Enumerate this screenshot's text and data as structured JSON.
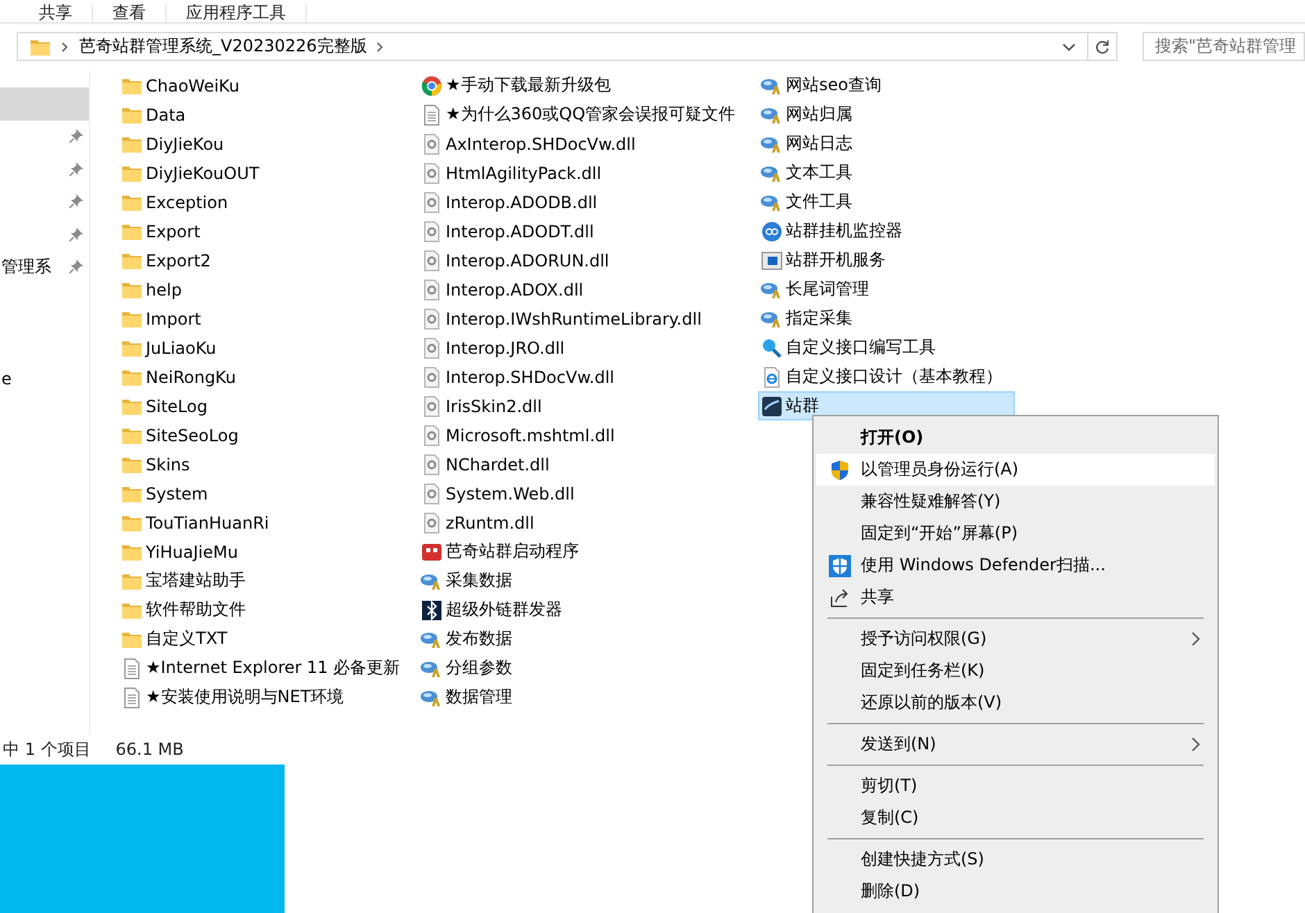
{
  "ribbon_tabs": [
    {
      "label": "共享"
    },
    {
      "label": "查看"
    },
    {
      "label": "应用程序工具"
    }
  ],
  "address_bar": {
    "path": "芭奇站群管理系统_V20230226完整版",
    "search_placeholder": "搜索\"芭奇站群管理"
  },
  "nav_pane": {
    "groups": [
      [
        {
          "selected": true,
          "pinned": false
        },
        {
          "selected": false,
          "pinned": true
        },
        {
          "selected": false,
          "pinned": true
        },
        {
          "selected": false,
          "pinned": true
        },
        {
          "selected": false,
          "pinned": true
        },
        {
          "selected": false,
          "pinned": true,
          "label": "管理系"
        }
      ],
      [
        {
          "selected": false,
          "pinned": false,
          "label": "e"
        }
      ]
    ]
  },
  "file_columns": [
    [
      {
        "name": "ChaoWeiKu",
        "kind": "folder",
        "selected": false
      },
      {
        "name": "Data",
        "kind": "folder",
        "selected": false
      },
      {
        "name": "DiyJieKou",
        "kind": "folder",
        "selected": false
      },
      {
        "name": "DiyJieKouOUT",
        "kind": "folder",
        "selected": false
      },
      {
        "name": "Exception",
        "kind": "folder",
        "selected": false
      },
      {
        "name": "Export",
        "kind": "folder",
        "selected": false
      },
      {
        "name": "Export2",
        "kind": "folder",
        "selected": false
      },
      {
        "name": "help",
        "kind": "folder",
        "selected": false
      },
      {
        "name": "Import",
        "kind": "folder",
        "selected": false
      },
      {
        "name": "JuLiaoKu",
        "kind": "folder",
        "selected": false
      },
      {
        "name": "NeiRongKu",
        "kind": "folder",
        "selected": false
      },
      {
        "name": "SiteLog",
        "kind": "folder",
        "selected": false
      },
      {
        "name": "SiteSeoLog",
        "kind": "folder",
        "selected": false
      },
      {
        "name": "Skins",
        "kind": "folder",
        "selected": false
      },
      {
        "name": "System",
        "kind": "folder",
        "selected": false
      },
      {
        "name": "TouTianHuanRi",
        "kind": "folder",
        "selected": false
      },
      {
        "name": "YiHuaJieMu",
        "kind": "folder",
        "selected": false
      },
      {
        "name": "宝塔建站助手",
        "kind": "folder",
        "selected": false
      },
      {
        "name": "软件帮助文件",
        "kind": "folder",
        "selected": false
      },
      {
        "name": "自定义TXT",
        "kind": "folder",
        "selected": false
      },
      {
        "name": "★Internet Explorer 11 必备更新",
        "kind": "text",
        "selected": false
      },
      {
        "name": "★安装使用说明与NET环境",
        "kind": "text",
        "selected": false
      }
    ],
    [
      {
        "name": "★手动下载最新升级包",
        "kind": "browser",
        "selected": false
      },
      {
        "name": "★为什么360或QQ管家会误报可疑文件",
        "kind": "text",
        "selected": false
      },
      {
        "name": "AxInterop.SHDocVw.dll",
        "kind": "dll",
        "selected": false
      },
      {
        "name": "HtmlAgilityPack.dll",
        "kind": "dll",
        "selected": false
      },
      {
        "name": "Interop.ADODB.dll",
        "kind": "dll",
        "selected": false
      },
      {
        "name": "Interop.ADODT.dll",
        "kind": "dll",
        "selected": false
      },
      {
        "name": "Interop.ADORUN.dll",
        "kind": "dll",
        "selected": false
      },
      {
        "name": "Interop.ADOX.dll",
        "kind": "dll",
        "selected": false
      },
      {
        "name": "Interop.IWshRuntimeLibrary.dll",
        "kind": "dll",
        "selected": false
      },
      {
        "name": "Interop.JRO.dll",
        "kind": "dll",
        "selected": false
      },
      {
        "name": "Interop.SHDocVw.dll",
        "kind": "dll",
        "selected": false
      },
      {
        "name": "IrisSkin2.dll",
        "kind": "dll",
        "selected": false
      },
      {
        "name": "Microsoft.mshtml.dll",
        "kind": "dll",
        "selected": false
      },
      {
        "name": "NChardet.dll",
        "kind": "dll",
        "selected": false
      },
      {
        "name": "System.Web.dll",
        "kind": "dll",
        "selected": false
      },
      {
        "name": "zRuntm.dll",
        "kind": "dll",
        "selected": false
      },
      {
        "name": "芭奇站群启动程序",
        "kind": "launcher",
        "selected": false
      },
      {
        "name": "采集数据",
        "kind": "network",
        "selected": false
      },
      {
        "name": "超级外链群发器",
        "kind": "bluetooth",
        "selected": false
      },
      {
        "name": "发布数据",
        "kind": "network",
        "selected": false
      },
      {
        "name": "分组参数",
        "kind": "network",
        "selected": false
      },
      {
        "name": "数据管理",
        "kind": "network",
        "selected": false
      }
    ],
    [
      {
        "name": "网站seo查询",
        "kind": "network",
        "selected": false
      },
      {
        "name": "网站归属",
        "kind": "network",
        "selected": false
      },
      {
        "name": "网站日志",
        "kind": "network",
        "selected": false
      },
      {
        "name": "文本工具",
        "kind": "network",
        "selected": false
      },
      {
        "name": "文件工具",
        "kind": "network",
        "selected": false
      },
      {
        "name": "站群挂机监控器",
        "kind": "globe",
        "selected": false
      },
      {
        "name": "站群开机服务",
        "kind": "service",
        "selected": false
      },
      {
        "name": "长尾词管理",
        "kind": "network",
        "selected": false
      },
      {
        "name": "指定采集",
        "kind": "network",
        "selected": false
      },
      {
        "name": "自定义接口编写工具",
        "kind": "magnifier",
        "selected": false
      },
      {
        "name": "自定义接口设计（基本教程）",
        "kind": "ie",
        "selected": false
      },
      {
        "name": "站群",
        "kind": "monitor",
        "selected": true
      }
    ]
  ],
  "status_bar": {
    "selection": "中 1 个项目",
    "size": "66.1 MB"
  },
  "context_menu": [
    {
      "kind": "item",
      "label": "打开(O)",
      "bold": true,
      "highlighted": false
    },
    {
      "kind": "shield",
      "label": "以管理员身份运行(A)",
      "highlighted": true
    },
    {
      "kind": "item",
      "label": "兼容性疑难解答(Y)",
      "highlighted": false
    },
    {
      "kind": "item",
      "label": "固定到“开始”屏幕(P)",
      "highlighted": false
    },
    {
      "kind": "defender",
      "label": "使用 Windows Defender扫描...",
      "highlighted": false
    },
    {
      "kind": "share",
      "label": "共享",
      "highlighted": false
    },
    {
      "kind": "separator"
    },
    {
      "kind": "item",
      "label": "授予访问权限(G)",
      "submenu": true,
      "highlighted": false
    },
    {
      "kind": "item",
      "label": "固定到任务栏(K)",
      "highlighted": false
    },
    {
      "kind": "item",
      "label": "还原以前的版本(V)",
      "highlighted": false
    },
    {
      "kind": "separator"
    },
    {
      "kind": "item",
      "label": "发送到(N)",
      "submenu": true,
      "highlighted": false
    },
    {
      "kind": "separator"
    },
    {
      "kind": "item",
      "label": "剪切(T)",
      "highlighted": false
    },
    {
      "kind": "item",
      "label": "复制(C)",
      "highlighted": false
    },
    {
      "kind": "separator"
    },
    {
      "kind": "item",
      "label": "创建快捷方式(S)",
      "highlighted": false
    },
    {
      "kind": "item",
      "label": "删除(D)",
      "highlighted": false
    }
  ]
}
